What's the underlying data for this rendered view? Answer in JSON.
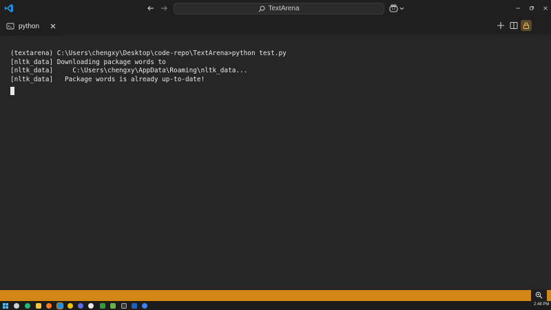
{
  "titlebar": {
    "search_text": "TextArena",
    "logo": "vscode-logo-icon",
    "accent": "#1e8fdf"
  },
  "tab": {
    "label": "python"
  },
  "terminal": {
    "lines": [
      "(textarena) C:\\Users\\chengxy\\Desktop\\code-repo\\TextArena>python test.py",
      "[nltk_data] Downloading package words to",
      "[nltk_data]     C:\\Users\\chengxy\\AppData\\Roaming\\nltk_data...",
      "[nltk_data]   Package words is already up-to-date!"
    ]
  },
  "statusbar": {
    "color": "#d18616"
  },
  "taskbar": {
    "time": "2:48 PM",
    "icons": [
      "start-icon",
      "search-icon",
      "edge-icon",
      "explorer-icon",
      "firefox-icon",
      "vscode-icon",
      "chrome-icon",
      "app-icon",
      "obs-icon",
      "app-icon",
      "terminal-icon",
      "app-icon",
      "app-icon",
      "app-icon"
    ]
  }
}
